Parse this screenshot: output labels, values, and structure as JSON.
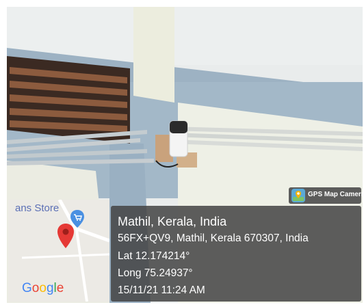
{
  "overlay": {
    "place_name": "Mathil, Kerala, India",
    "address": "56FX+QV9, Mathil, Kerala 670307, India",
    "latitude": "Lat 12.174214°",
    "longitude": "Long 75.24937°",
    "timestamp": "15/11/21 11:24 AM"
  },
  "app_badge": {
    "name": "GPS Map Camera",
    "icon": "gps-map-camera-app-icon"
  },
  "map": {
    "store_label": "ans Store",
    "store_marker_icon": "shopping-cart-pin-icon",
    "location_marker_icon": "red-location-pin-icon",
    "google_letters": [
      "G",
      "o",
      "o",
      "g",
      "l",
      "e"
    ],
    "google_colors": [
      "#4285F4",
      "#EA4335",
      "#FBBC05",
      "#4285F4",
      "#34A853",
      "#EA4335"
    ]
  },
  "colors": {
    "overlay_background": "#444444",
    "pin_red": "#e53935",
    "store_pin_blue": "#4a90e2"
  }
}
